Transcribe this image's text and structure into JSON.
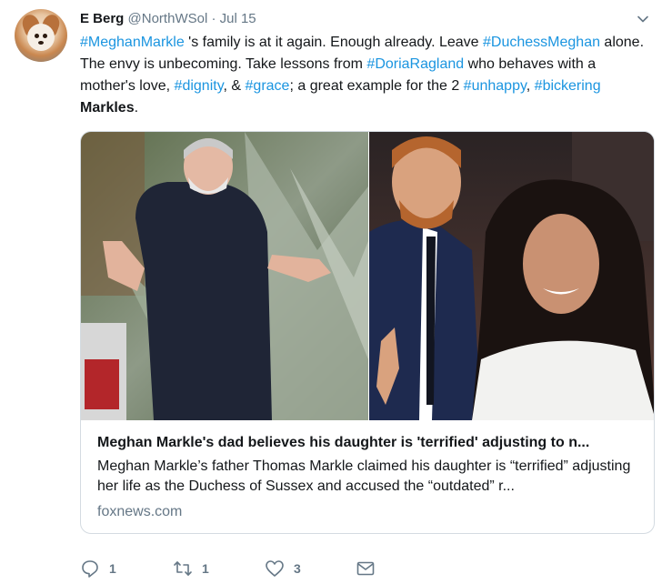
{
  "author": {
    "name": "E Berg",
    "handle": "@NorthWSol",
    "separator": "·",
    "date": "Jul 15"
  },
  "tweet_segments": [
    {
      "text": "#MeghanMarkle",
      "type": "hashtag"
    },
    {
      "text": " 's family is at it again. Enough already. Leave ",
      "type": "plain"
    },
    {
      "text": "#DuchessMeghan",
      "type": "hashtag"
    },
    {
      "text": " alone. The envy is unbecoming. Take lessons from ",
      "type": "plain"
    },
    {
      "text": "#DoriaRagland",
      "type": "hashtag"
    },
    {
      "text": " who behaves with a mother's love, ",
      "type": "plain"
    },
    {
      "text": "#dignity",
      "type": "hashtag"
    },
    {
      "text": ", & ",
      "type": "plain"
    },
    {
      "text": "#grace",
      "type": "hashtag"
    },
    {
      "text": "; a great example for the 2 ",
      "type": "plain"
    },
    {
      "text": "#unhappy",
      "type": "hashtag"
    },
    {
      "text": ", ",
      "type": "plain"
    },
    {
      "text": "#bickering",
      "type": "hashtag"
    },
    {
      "text": " ",
      "type": "plain"
    },
    {
      "text": "Markles",
      "type": "bold"
    },
    {
      "text": ".",
      "type": "plain"
    }
  ],
  "card": {
    "title": "Meghan Markle's dad believes his daughter is 'terrified' adjusting to n...",
    "description": "Meghan Markle’s father Thomas Markle claimed his daughter is “terrified” adjusting her life as the Duchess of Sussex and accused the “outdated” r...",
    "domain": "foxnews.com"
  },
  "actions": {
    "reply_count": "1",
    "retweet_count": "1",
    "like_count": "3"
  },
  "colors": {
    "hashtag": "#1b95e0",
    "muted": "#657786",
    "text": "#14171a",
    "border": "#d4dbe1"
  },
  "icons": [
    "avatar-dog",
    "chevron-down-icon",
    "reply-icon",
    "retweet-icon",
    "like-icon",
    "dm-icon"
  ]
}
